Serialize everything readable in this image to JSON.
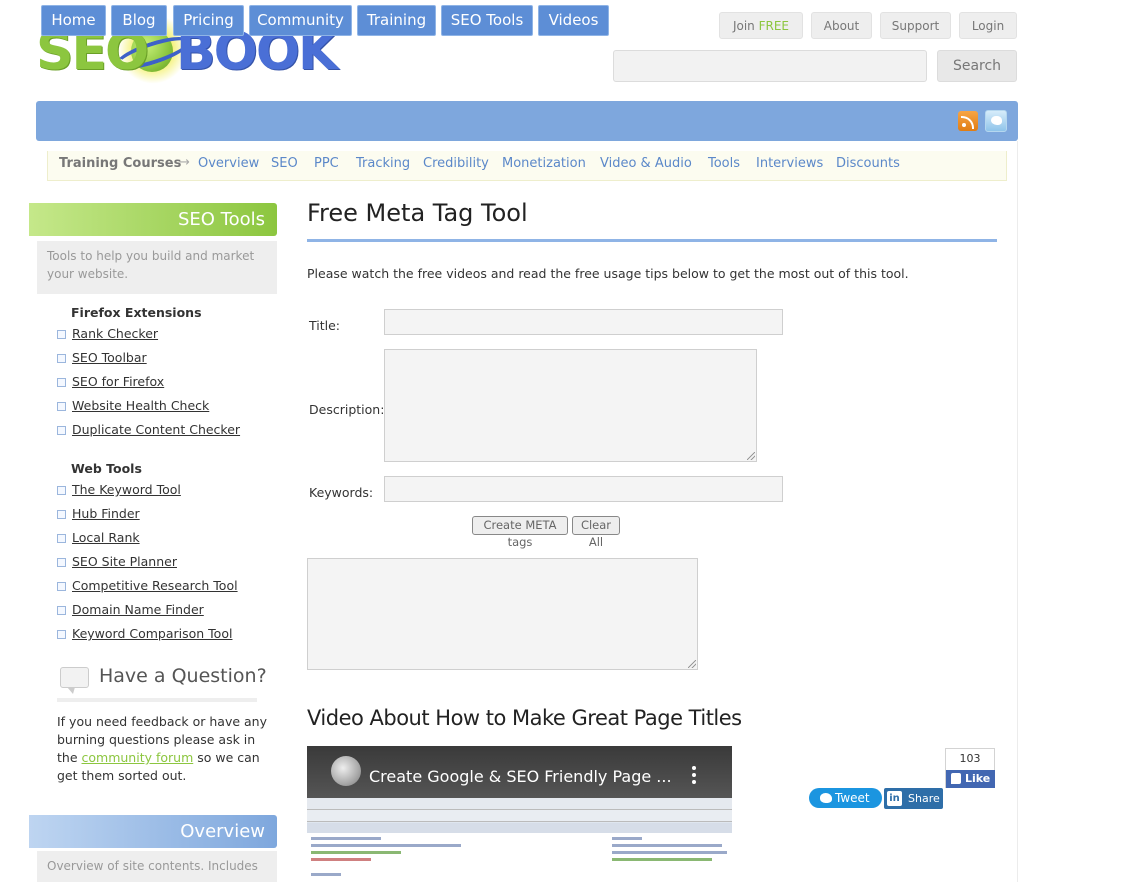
{
  "logo": {
    "seo": "SEO",
    "book": "BOOK"
  },
  "toplinks": {
    "join": "Join ",
    "join_free": "FREE",
    "about": "About",
    "support": "Support",
    "login": "Login"
  },
  "search": {
    "button": "Search",
    "placeholder": ""
  },
  "nav": [
    "Home",
    "Blog",
    "Pricing",
    "Community",
    "Training",
    "SEO Tools",
    "Videos"
  ],
  "subnav": {
    "label": "Training Courses",
    "arrow": "→",
    "links": [
      "Overview",
      "SEO",
      "PPC",
      "Tracking",
      "Credibility",
      "Monetization",
      "Video & Audio",
      "Tools",
      "Interviews",
      "Discounts"
    ]
  },
  "sidebar": {
    "tools_heading": "SEO Tools",
    "tools_desc": "Tools to help you build and market your website.",
    "firefox_title": "Firefox Extensions",
    "firefox_links": [
      "Rank Checker",
      "SEO Toolbar",
      "SEO for Firefox",
      "Website Health Check",
      "Duplicate Content Checker"
    ],
    "web_title": "Web Tools",
    "web_links": [
      "The Keyword Tool",
      "Hub Finder",
      "Local Rank",
      "SEO Site Planner",
      "Competitive Research Tool",
      "Domain Name Finder",
      "Keyword Comparison Tool"
    ],
    "question_title": "Have a Question?",
    "question_text_1": "If you need feedback or have any burning questions please ask in the ",
    "question_link": "community forum",
    "question_text_2": " so we can get them sorted out.",
    "overview_heading": "Overview",
    "overview_desc": "Overview of site contents. Includes"
  },
  "main": {
    "title": "Free Meta Tag Tool",
    "intro": "Please watch the free videos and read the free usage tips below to get the most out of this tool.",
    "labels": {
      "title": "Title:",
      "description": "Description:",
      "keywords": "Keywords:"
    },
    "buttons": {
      "create": "Create META tags",
      "clear": "Clear All"
    },
    "video_heading": "Video About How to Make Great Page Titles",
    "video_title": "Create Google & SEO Friendly Page ..."
  },
  "social": {
    "fb_count": "103",
    "fb_like": "Like",
    "tweet": "Tweet",
    "share": "Share"
  },
  "colors": {
    "green": "#8cc63f",
    "blue": "#7ea7dd",
    "nav_button": "#5d8ed6"
  }
}
